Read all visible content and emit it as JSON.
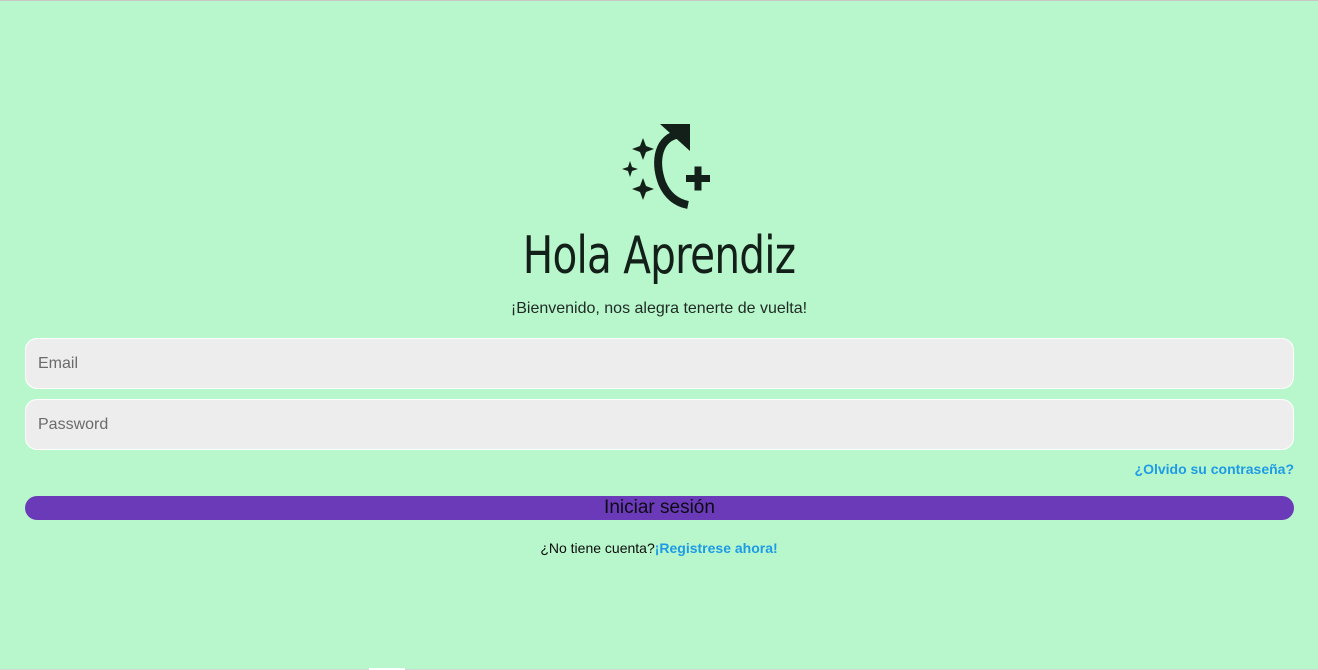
{
  "logo": {
    "icon": "sparkle-rotate-plus-icon",
    "color": "#13201a"
  },
  "heading": "Hola Aprendiz",
  "subtitle": "¡Bienvenido, nos alegra tenerte de vuelta!",
  "form": {
    "email_placeholder": "Email",
    "email_value": "",
    "password_placeholder": "Password",
    "password_value": "",
    "forgot_label": "¿Olvido su contraseña?",
    "submit_label": "Iniciar sesión"
  },
  "register": {
    "prompt": "¿No tiene cuenta?",
    "link_label": "¡Registrese ahora!"
  },
  "colors": {
    "background": "#b8f6cb",
    "primary_button": "#6a3ab8",
    "link": "#1e9be6",
    "input_bg": "#ededed"
  }
}
